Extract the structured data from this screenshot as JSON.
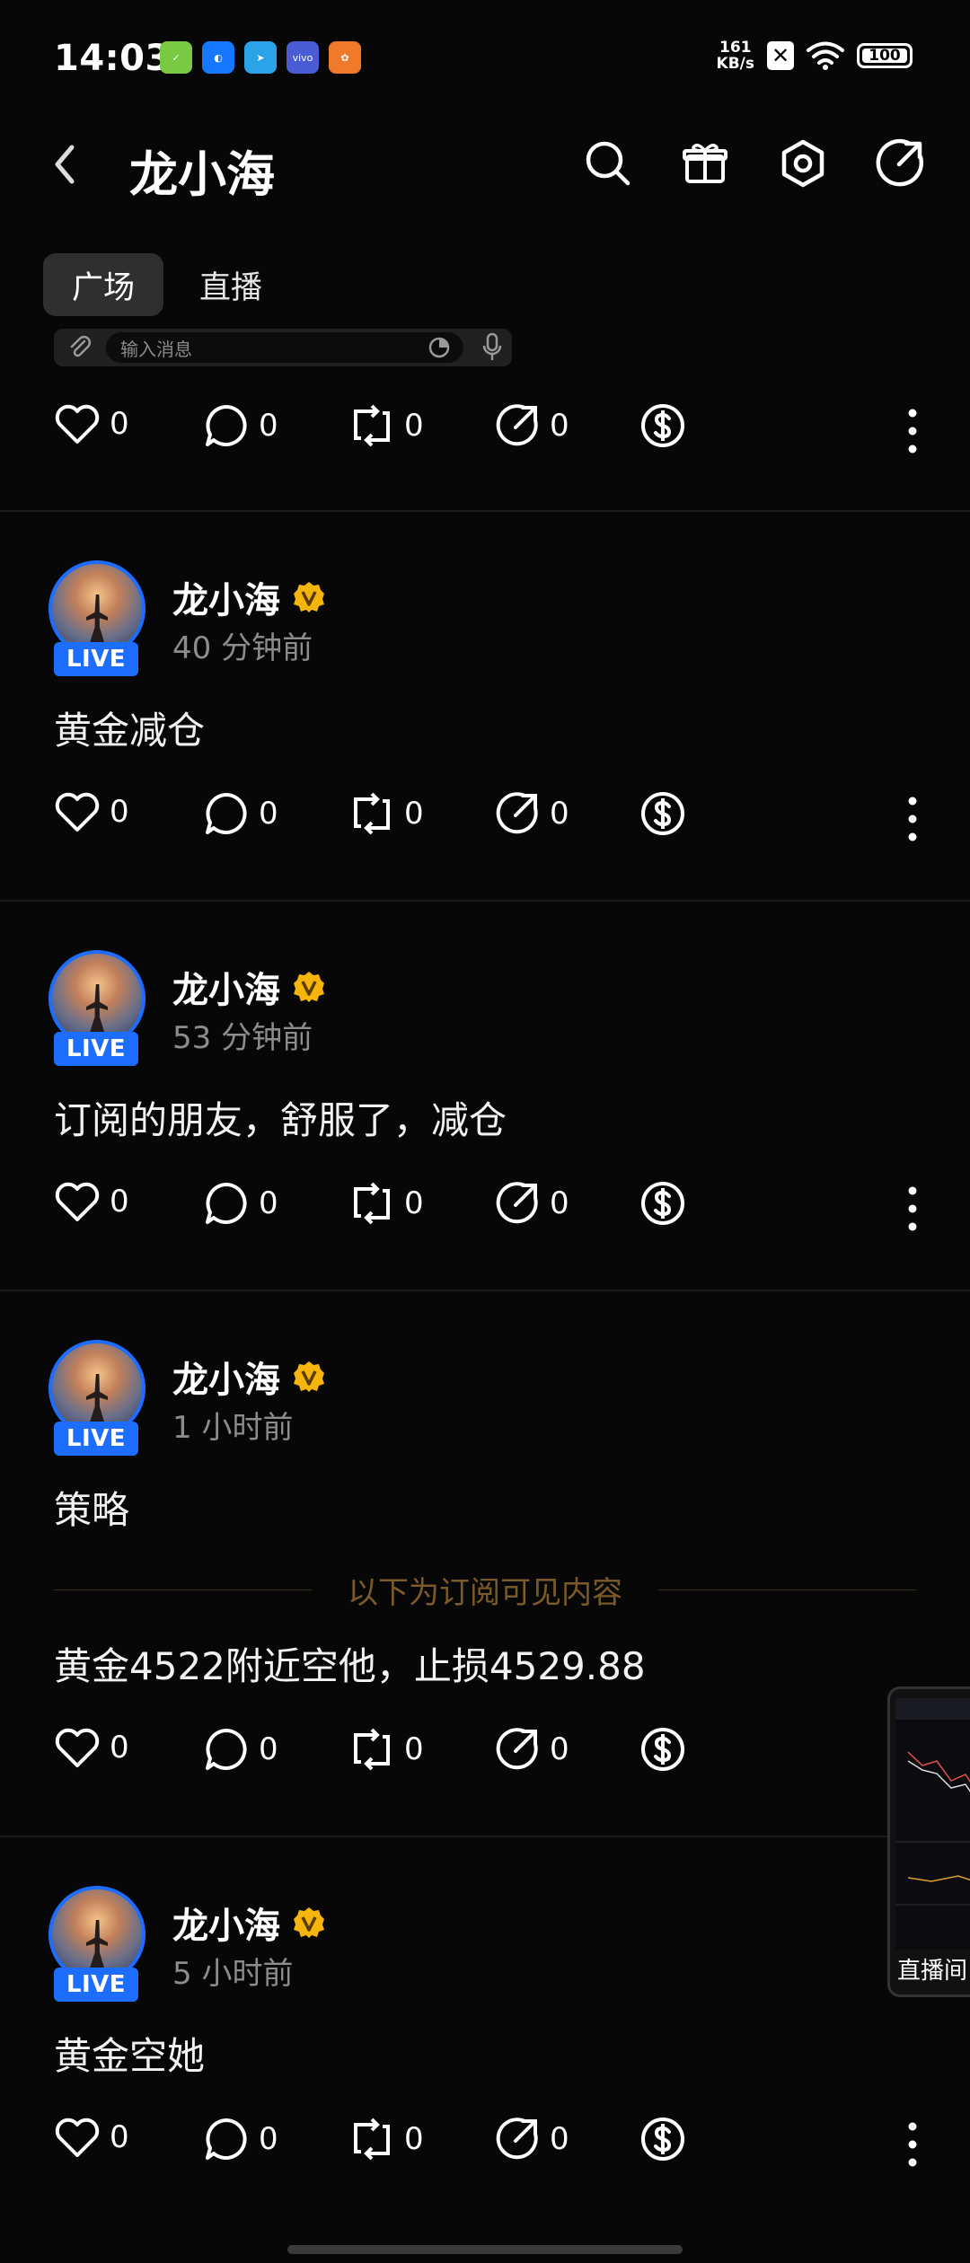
{
  "status": {
    "time": "14:03",
    "netspeed_value": "161",
    "netspeed_unit": "KB/s",
    "battery": "100"
  },
  "header": {
    "title": "龙小海"
  },
  "tabs": [
    {
      "label": "广场"
    },
    {
      "label": "直播"
    }
  ],
  "input": {
    "placeholder": "输入消息"
  },
  "top_actions": {
    "like": "0",
    "comment": "0",
    "repost": "0",
    "share": "0"
  },
  "posts": [
    {
      "author": "龙小海",
      "live": "LIVE",
      "time": "40 分钟前",
      "text": "黄金减仓",
      "like": "0",
      "comment": "0",
      "repost": "0",
      "share": "0"
    },
    {
      "author": "龙小海",
      "live": "LIVE",
      "time": "53 分钟前",
      "text": "订阅的朋友，舒服了，减仓",
      "like": "0",
      "comment": "0",
      "repost": "0",
      "share": "0"
    },
    {
      "author": "龙小海",
      "live": "LIVE",
      "time": "1 小时前",
      "text": "策略",
      "subscriber_divider": "以下为订阅可见内容",
      "subscriber_text": "黄金4522附近空他，止损4529.88",
      "like": "0",
      "comment": "0",
      "repost": "0",
      "share": "0"
    },
    {
      "author": "龙小海",
      "live": "LIVE",
      "time": "5 小时前",
      "text": "黄金空她",
      "like": "0",
      "comment": "0",
      "repost": "0",
      "share": "0"
    }
  ],
  "floating_live": {
    "label": "直播间"
  }
}
